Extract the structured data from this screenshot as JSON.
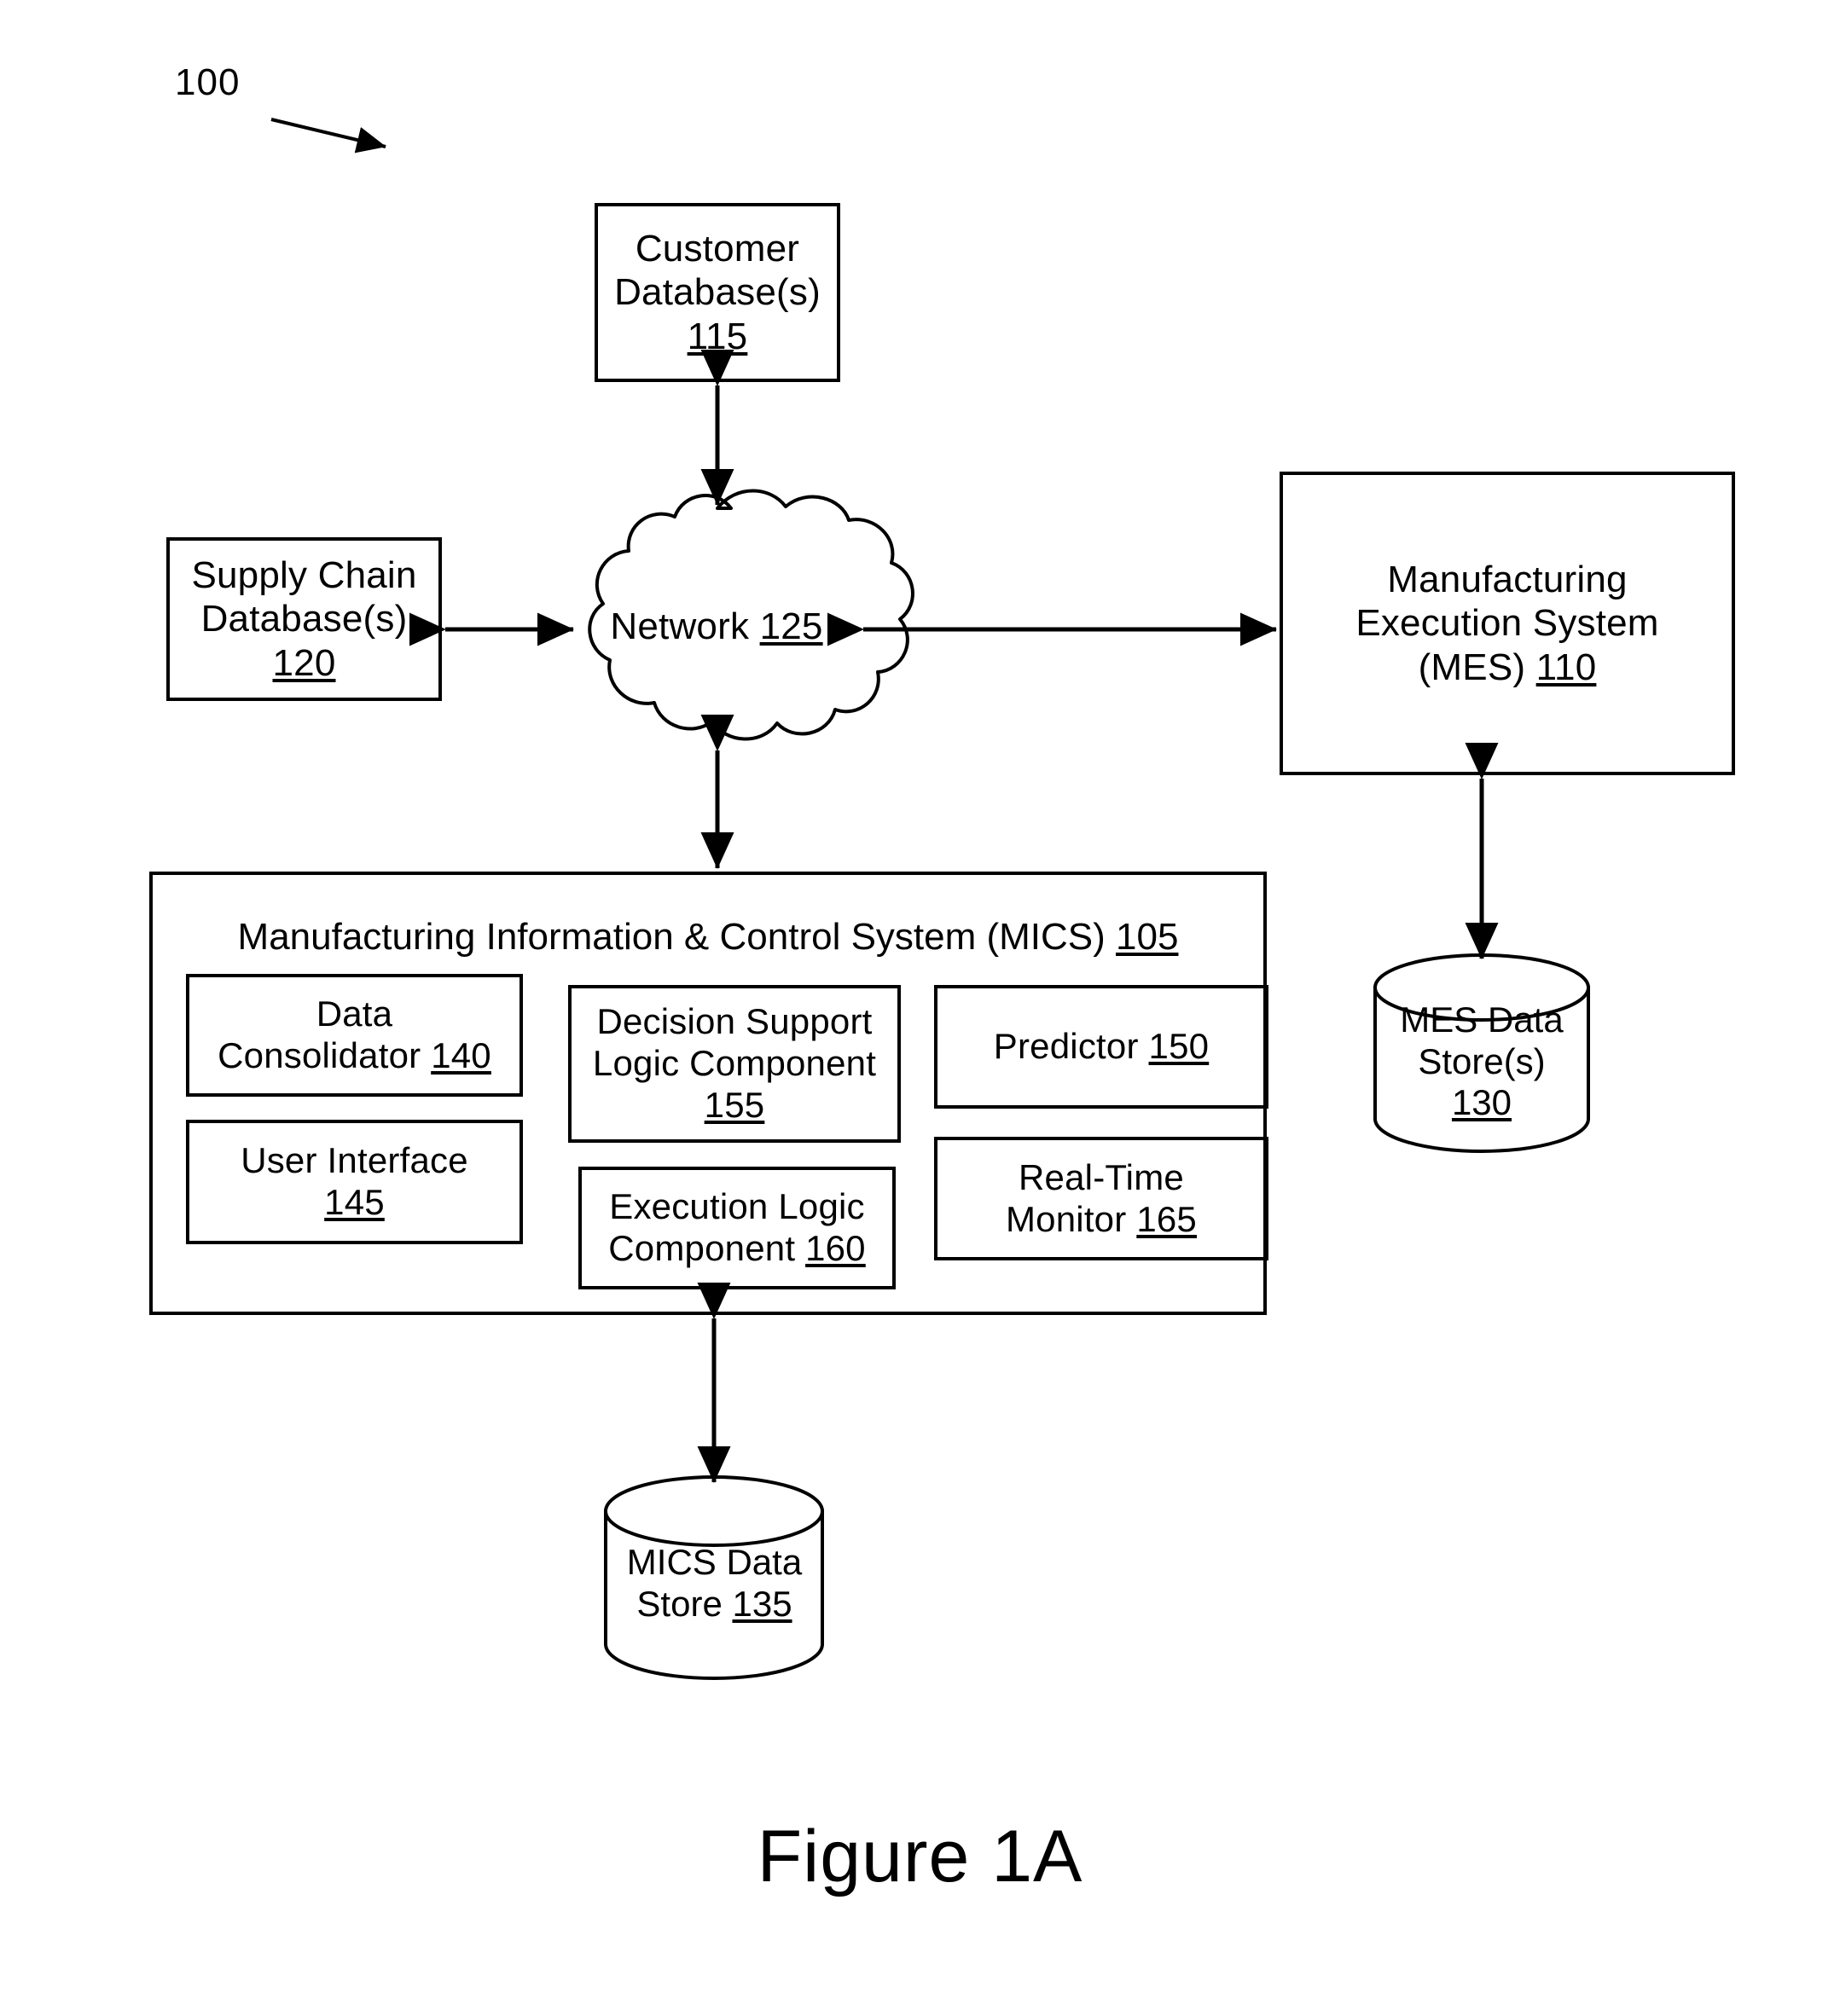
{
  "figure": {
    "system_ref": "100",
    "caption": "Figure 1A"
  },
  "nodes": {
    "customer_db": {
      "label": "Customer\nDatabase(s)\n",
      "ref": "115"
    },
    "supply_chain_db": {
      "label": "Supply Chain\nDatabase(s)\n",
      "ref": "120"
    },
    "network": {
      "label": "Network ",
      "ref": "125"
    },
    "mes": {
      "label": "Manufacturing\nExecution System\n(MES) ",
      "ref": "110"
    },
    "mes_datastore": {
      "label": "MES Data\nStore(s)\n",
      "ref": "130"
    },
    "mics_datastore": {
      "label": "MICS Data\nStore ",
      "ref": "135"
    },
    "mics": {
      "title": "Manufacturing Information & Control System (MICS) ",
      "ref": "105",
      "components": [
        {
          "name": "data-consolidator",
          "label": "Data\nConsolidator ",
          "ref": "140"
        },
        {
          "name": "user-interface",
          "label": "User Interface\n",
          "ref": "145"
        },
        {
          "name": "decision-support-logic",
          "label": "Decision Support\nLogic Component\n",
          "ref": "155"
        },
        {
          "name": "execution-logic",
          "label": "Execution Logic\nComponent ",
          "ref": "160"
        },
        {
          "name": "predictor",
          "label": "Predictor ",
          "ref": "150"
        },
        {
          "name": "real-time-monitor",
          "label": "Real-Time\nMonitor ",
          "ref": "165"
        }
      ]
    }
  },
  "connectors": [
    {
      "name": "customer-db-to-network",
      "from": "customer_db",
      "to": "network",
      "type": "bidirectional"
    },
    {
      "name": "supply-chain-db-to-network",
      "from": "supply_chain_db",
      "to": "network",
      "type": "bidirectional"
    },
    {
      "name": "network-to-mes",
      "from": "network",
      "to": "mes",
      "type": "bidirectional"
    },
    {
      "name": "network-to-mics",
      "from": "network",
      "to": "mics",
      "type": "bidirectional"
    },
    {
      "name": "mes-to-mes-datastore",
      "from": "mes",
      "to": "mes_datastore",
      "type": "bidirectional"
    },
    {
      "name": "mics-to-mics-datastore",
      "from": "mics",
      "to": "mics_datastore",
      "type": "bidirectional"
    }
  ],
  "colors": {
    "stroke": "#000000",
    "background": "#ffffff"
  }
}
